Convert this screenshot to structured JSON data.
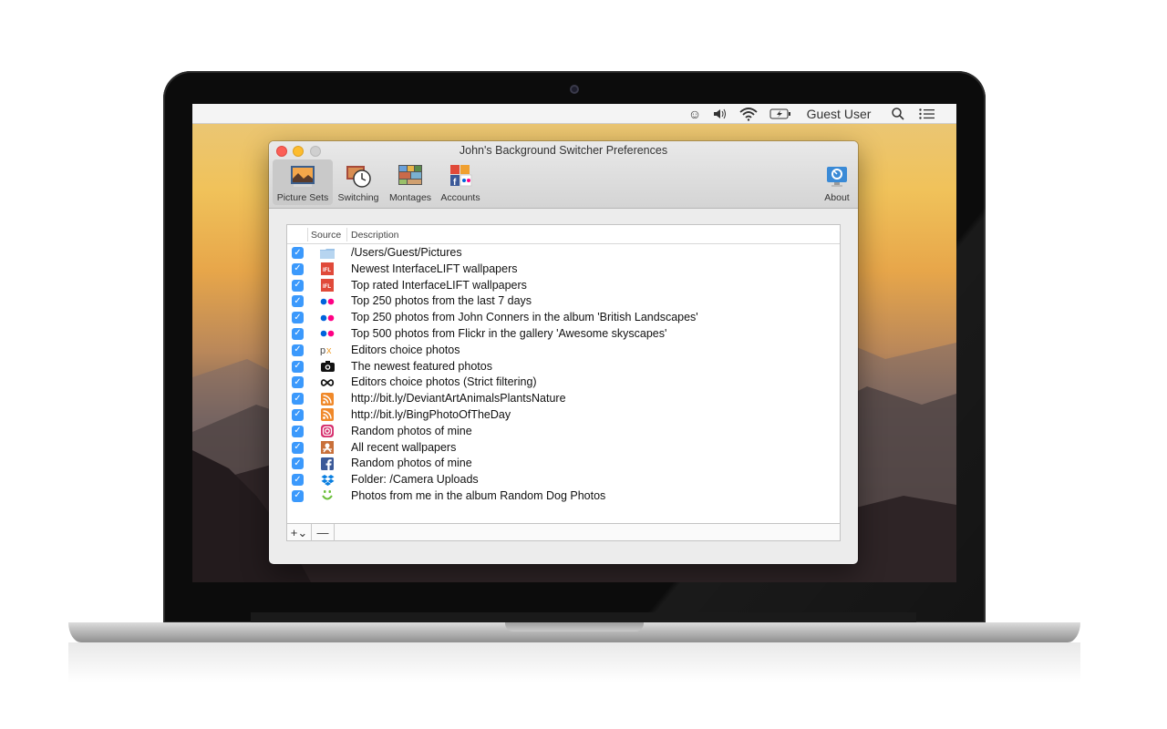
{
  "menubar": {
    "user": "Guest User"
  },
  "window": {
    "title": "John's Background Switcher Preferences",
    "toolbar": [
      {
        "label": "Picture Sets",
        "icon": "picture-sets-icon",
        "active": true
      },
      {
        "label": "Switching",
        "icon": "switching-clock-icon",
        "active": false
      },
      {
        "label": "Montages",
        "icon": "montages-icon",
        "active": false
      },
      {
        "label": "Accounts",
        "icon": "accounts-icon",
        "active": false
      },
      {
        "label": "About",
        "icon": "about-icon",
        "active": false
      }
    ]
  },
  "table": {
    "columns": {
      "source": "Source",
      "description": "Description"
    },
    "rows": [
      {
        "checked": true,
        "source_icon": "folder-icon",
        "description": "/Users/Guest/Pictures"
      },
      {
        "checked": true,
        "source_icon": "interfacelift-icon",
        "description": "Newest InterfaceLIFT wallpapers"
      },
      {
        "checked": true,
        "source_icon": "interfacelift-icon",
        "description": "Top rated InterfaceLIFT wallpapers"
      },
      {
        "checked": true,
        "source_icon": "flickr-icon",
        "description": "Top 250 photos from the last 7 days"
      },
      {
        "checked": true,
        "source_icon": "flickr-icon",
        "description": "Top 250 photos from John Conners in the album 'British Landscapes'"
      },
      {
        "checked": true,
        "source_icon": "flickr-icon",
        "description": "Top 500 photos from Flickr in the gallery 'Awesome skyscapes'"
      },
      {
        "checked": true,
        "source_icon": "500px-icon",
        "description": "Editors choice photos"
      },
      {
        "checked": true,
        "source_icon": "camera-icon",
        "description": "The newest featured photos"
      },
      {
        "checked": true,
        "source_icon": "infinity-icon",
        "description": "Editors choice photos (Strict filtering)"
      },
      {
        "checked": true,
        "source_icon": "rss-icon",
        "description": "http://bit.ly/DeviantArtAnimalsPlantsNature"
      },
      {
        "checked": true,
        "source_icon": "rss-icon",
        "description": "http://bit.ly/BingPhotoOfTheDay"
      },
      {
        "checked": true,
        "source_icon": "instagram-icon",
        "description": "Random photos of mine"
      },
      {
        "checked": true,
        "source_icon": "wallpapers-icon",
        "description": "All recent wallpapers"
      },
      {
        "checked": true,
        "source_icon": "facebook-icon",
        "description": "Random photos of mine"
      },
      {
        "checked": true,
        "source_icon": "dropbox-icon",
        "description": "Folder: /Camera Uploads"
      },
      {
        "checked": true,
        "source_icon": "smugmug-icon",
        "description": "Photos from me in the album Random Dog Photos"
      }
    ],
    "footer": {
      "add_label": "+⌄",
      "remove_label": "—"
    }
  }
}
